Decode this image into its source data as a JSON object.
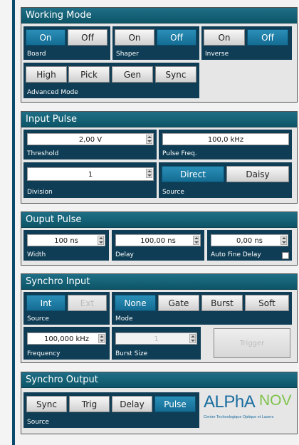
{
  "working_mode": {
    "title": "Working Mode",
    "board": {
      "label": "Board",
      "on": "On",
      "off": "Off"
    },
    "shaper": {
      "label": "Shaper",
      "on": "On",
      "off": "Off"
    },
    "inverse": {
      "label": "Inverse",
      "on": "On",
      "off": "Off"
    },
    "advanced": {
      "label": "Advanced Mode",
      "high": "High",
      "pick": "Pick",
      "gen": "Gen",
      "sync": "Sync"
    }
  },
  "input_pulse": {
    "title": "Input Pulse",
    "threshold": {
      "label": "Threshold",
      "value": "2,00 V"
    },
    "pulse_freq": {
      "label": "Pulse Freq.",
      "value": "100,0 kHz"
    },
    "division": {
      "label": "Division",
      "value": "1"
    },
    "source": {
      "label": "Source",
      "direct": "Direct",
      "daisy": "Daisy"
    }
  },
  "output_pulse": {
    "title": "Ouput Pulse",
    "width": {
      "label": "Width",
      "value": "100 ns"
    },
    "delay": {
      "label": "Delay",
      "value": "100,00 ns"
    },
    "auto_fine_delay": {
      "label": "Auto Fine Delay",
      "value": "0,00 ns",
      "checked": false
    }
  },
  "synchro_input": {
    "title": "Synchro Input",
    "source": {
      "label": "Source",
      "int": "Int",
      "ext": "Ext"
    },
    "mode": {
      "label": "Mode",
      "none": "None",
      "gate": "Gate",
      "burst": "Burst",
      "soft": "Soft"
    },
    "frequency": {
      "label": "Frequency",
      "value": "100,000 kHz"
    },
    "burst_size": {
      "label": "Burst Size",
      "value": "1"
    },
    "trigger": "Trigger"
  },
  "synchro_output": {
    "title": "Synchro Output",
    "source": {
      "label": "Source",
      "sync": "Sync",
      "trig": "Trig",
      "delay": "Delay",
      "pulse": "Pulse"
    }
  },
  "logo": {
    "alpha": "ALPhA",
    "nov": "NOV",
    "tagline": "Centre Technologique Optique et Lasers"
  },
  "colors": {
    "accent": "#146c93",
    "header": "#0d5568",
    "caption_bg": "#0e3d55"
  }
}
